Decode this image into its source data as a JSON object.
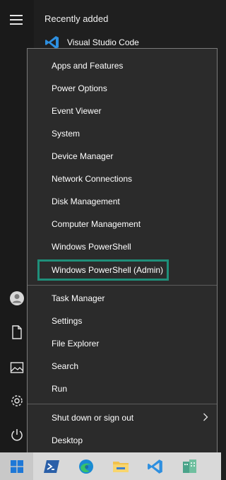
{
  "start_menu": {
    "section_title": "Recently added",
    "recent_items": [
      {
        "label": "Visual Studio Code",
        "icon": "vscode-icon"
      }
    ],
    "rail_icons": [
      "menu-icon",
      "user-icon",
      "document-icon",
      "pictures-icon",
      "settings-icon",
      "power-icon"
    ]
  },
  "context_menu": {
    "items": [
      {
        "label": "Apps and Features"
      },
      {
        "label": "Power Options"
      },
      {
        "label": "Event Viewer"
      },
      {
        "label": "System"
      },
      {
        "label": "Device Manager"
      },
      {
        "label": "Network Connections"
      },
      {
        "label": "Disk Management"
      },
      {
        "label": "Computer Management"
      },
      {
        "label": "Windows PowerShell"
      },
      {
        "label": "Windows PowerShell (Admin)",
        "highlighted": true
      },
      {
        "label": "Task Manager"
      },
      {
        "label": "Settings"
      },
      {
        "label": "File Explorer"
      },
      {
        "label": "Search"
      },
      {
        "label": "Run"
      },
      {
        "label": "Shut down or sign out",
        "has_submenu": true
      },
      {
        "label": "Desktop"
      }
    ],
    "highlight_color": "#1f8f7a"
  },
  "taskbar": {
    "apps": [
      "windows-start-icon",
      "powershell-icon",
      "edge-icon",
      "file-explorer-icon",
      "vscode-icon",
      "other-app-icon"
    ]
  }
}
